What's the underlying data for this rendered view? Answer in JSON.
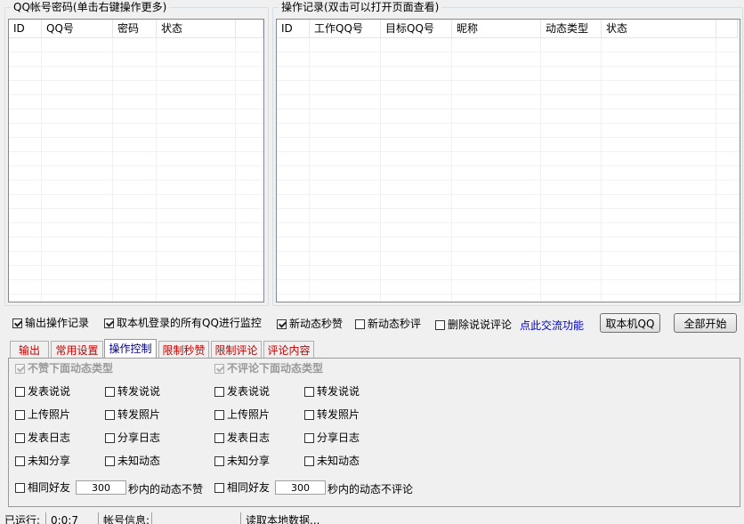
{
  "accounts_panel": {
    "title": "QQ帐号密码(单击右键操作更多)",
    "columns": [
      "ID",
      "QQ号",
      "密码",
      "状态",
      ""
    ]
  },
  "log_panel": {
    "title": "操作记录(双击可以打开页面查看)",
    "columns": [
      "ID",
      "工作QQ号",
      "目标QQ号",
      "昵称",
      "动态类型",
      "状态",
      ""
    ]
  },
  "options": {
    "output_log": {
      "label": "输出操作记录",
      "checked": true
    },
    "monitor_local": {
      "label": "取本机登录的所有QQ进行监控",
      "checked": true
    },
    "new_feed_like": {
      "label": "新动态秒赞",
      "checked": true
    },
    "new_feed_comment": {
      "label": "新动态秒评",
      "checked": false
    },
    "delete_comment": {
      "label": "删除说说评论",
      "checked": false
    },
    "exchange_link": "点此交流功能",
    "get_local_qq_button": "取本机QQ",
    "start_all_button": "全部开始"
  },
  "tabs": [
    "输出",
    "常用设置",
    "操作控制",
    "限制秒赞",
    "限制评论",
    "评论内容"
  ],
  "active_tab": "操作控制",
  "control": {
    "no_like_title": "不赞下面动态类型",
    "no_comment_title": "不评论下面动态类型",
    "left_types": [
      "发表说说",
      "转发说说",
      "上传照片",
      "转发照片",
      "发表日志",
      "分享日志",
      "未知分享",
      "未知动态"
    ],
    "right_types": [
      "发表说说",
      "转发说说",
      "上传照片",
      "转发照片",
      "发表日志",
      "分享日志",
      "未知分享",
      "未知动态"
    ],
    "same_friend_label": "相同好友",
    "like_seconds": "300",
    "like_suffix": "秒内的动态不赞",
    "comment_seconds": "300",
    "comment_suffix": "秒内的动态不评论"
  },
  "status_bar": {
    "running_label": "已运行:",
    "running_time": "0:0:7",
    "account_label": "帐号信息:",
    "message": "读取本地数据..."
  }
}
